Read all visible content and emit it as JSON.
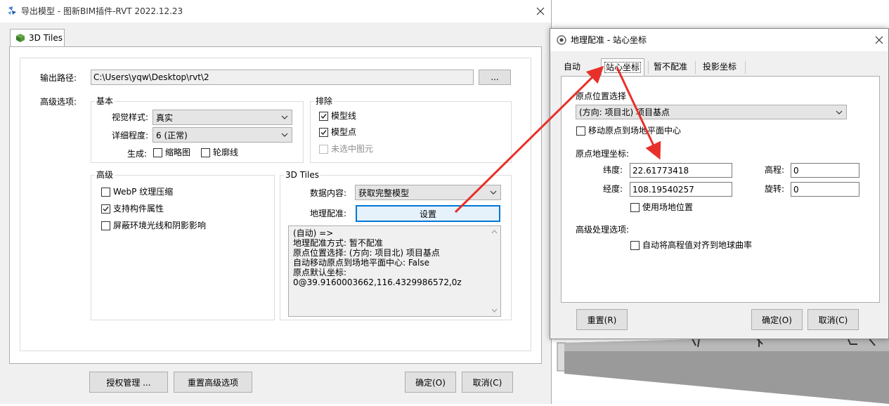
{
  "main_window": {
    "title": "导出模型 - 图新BIM插件-RVT 2022.12.23",
    "tab": "3D Tiles",
    "output_label": "输出路径:",
    "output_path": "C:\\Users\\yqw\\Desktop\\rvt\\2",
    "browse_label": "...",
    "advanced_label": "高级选项:",
    "basic_group": "基本",
    "visual_style_label": "视觉样式:",
    "visual_style_value": "真实",
    "detail_label": "详细程度:",
    "detail_value": "6 (正常)",
    "generate_label": "生成:",
    "thumbnail_label": "缩略图",
    "outline_label": "轮廓线",
    "exclude_group": "排除",
    "model_line_label": "模型线",
    "model_point_label": "模型点",
    "unselected_label": "未选中图元",
    "adv_group": "高级",
    "webp_label": "WebP 纹理压缩",
    "component_attr_label": "支持构件属性",
    "ambient_label": "屏蔽环境光线和阴影影响",
    "tiles_group": "3D Tiles",
    "data_content_label": "数据内容:",
    "data_content_value": "获取完整模型",
    "georef_label": "地理配准:",
    "settings_button": "设置",
    "info_lines": [
      "(自动) =>",
      "地理配准方式: 暂不配准",
      "原点位置选择: (方向: 项目北) 项目基点",
      "自动移动原点到场地平面中心: False",
      "原点默认坐标:",
      "0@39.9160003662,116.4329986572,0z"
    ],
    "license_button": "授权管理 ...",
    "reset_advanced_button": "重置高级选项",
    "ok_button": "确定(O)",
    "cancel_button": "取消(C)"
  },
  "geo_dialog": {
    "title": "地理配准 - 站心坐标",
    "tabs": [
      "自动",
      "站心坐标",
      "暂不配准",
      "投影坐标"
    ],
    "origin_section": "原点位置选择",
    "origin_value": "(方向: 项目北) 项目基点",
    "move_origin_label": "移动原点到场地平面中心",
    "coord_section": "原点地理坐标:",
    "lat_label": "纬度:",
    "lat_value": "22.61773418",
    "lon_label": "经度:",
    "lon_value": "108.19540257",
    "elev_label": "高程:",
    "elev_value": "0",
    "rot_label": "旋转:",
    "rot_value": "0",
    "use_site_label": "使用场地位置",
    "adv_section": "高级处理选项:",
    "align_label": "自动将高程值对齐到地球曲率",
    "reset_button": "重置(R)",
    "ok_button": "确定(O)",
    "cancel_button": "取消(C)"
  },
  "colors": {
    "accent": "#0078d7",
    "arrow": "#e8302a",
    "button_bg": "#e1e1e1",
    "panel_bg": "#f0f0f0"
  }
}
